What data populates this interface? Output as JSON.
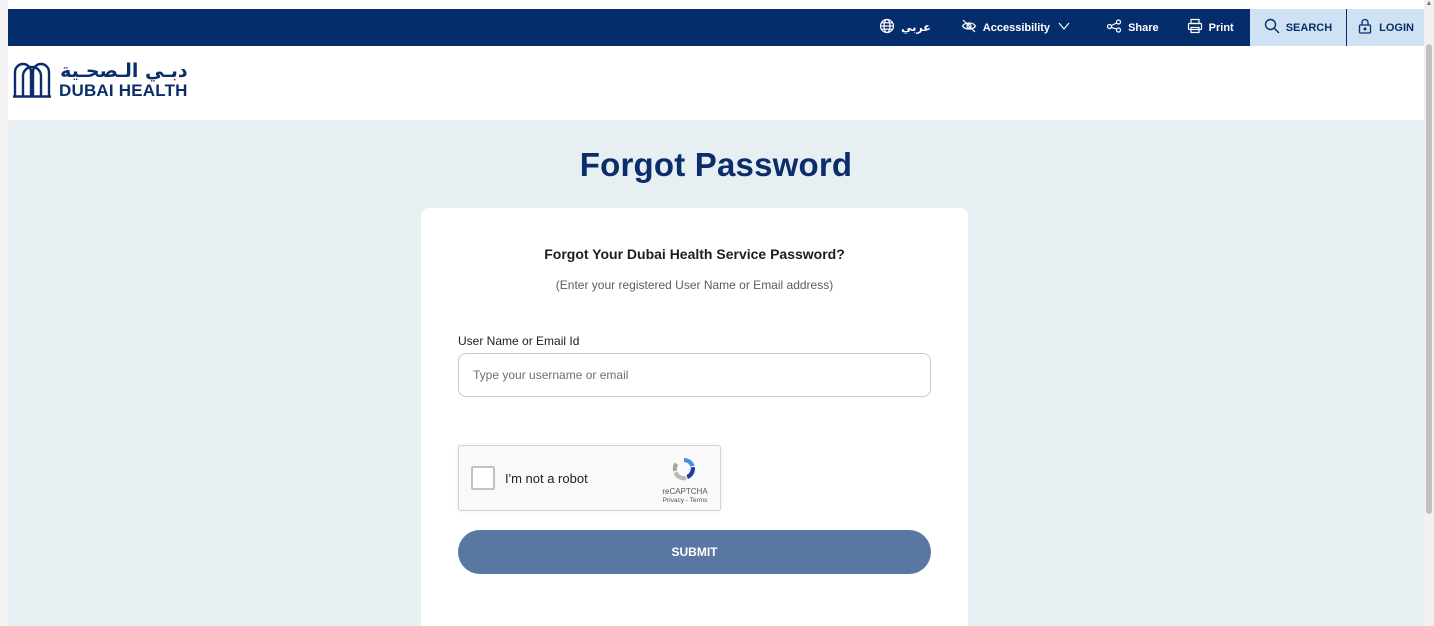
{
  "topbar": {
    "language_label": "عربي",
    "accessibility_label": "Accessibility",
    "share_label": "Share",
    "print_label": "Print",
    "search_label": "SEARCH",
    "login_label": "LOGIN"
  },
  "logo": {
    "arabic": "دبـي الـصحـية",
    "english": "DUBAI HEALTH"
  },
  "page": {
    "title": "Forgot Password"
  },
  "card": {
    "heading": "Forgot Your Dubai Health Service Password?",
    "subheading": "(Enter your registered User Name or Email address)",
    "field_label": "User Name or Email Id",
    "field_placeholder": "Type your username or email",
    "field_value": "",
    "recaptcha_label": "I'm not a robot",
    "recaptcha_brand": "reCAPTCHA",
    "recaptcha_terms": "Privacy - Terms",
    "submit_label": "SUBMIT"
  },
  "colors": {
    "primary_navy": "#062d6b",
    "page_bg": "#e7eff3",
    "button": "#5a76a3",
    "topbar_highlight": "#cfe2f3"
  }
}
